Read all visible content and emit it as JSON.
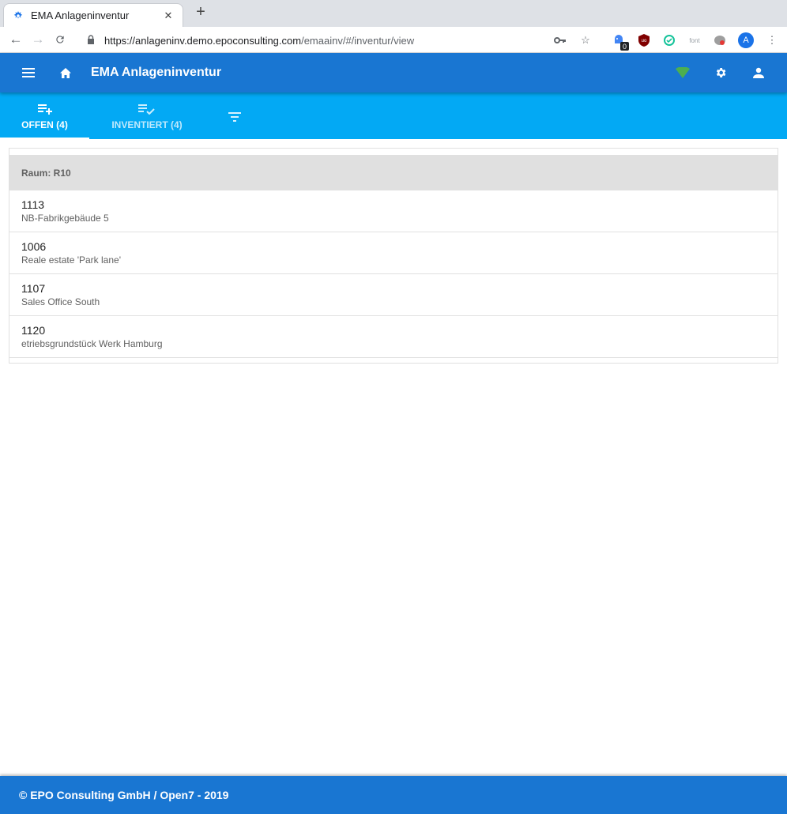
{
  "browser": {
    "tab_title": "EMA Anlageninventur",
    "url_host": "https://anlageninv.demo.epoconsulting.com",
    "url_path": "/emaainv/#/inventur/view",
    "ext_badge": "0",
    "font_ext_label": "font",
    "profile_initial": "A"
  },
  "header": {
    "title": "EMA Anlageninventur",
    "status_color": "#4caf50"
  },
  "tabs": [
    {
      "label": "OFFEN (4)",
      "icon": "playlist-add-icon",
      "active": true
    },
    {
      "label": "INVENTIERT (4)",
      "icon": "playlist-check-icon",
      "active": false
    },
    {
      "label": "",
      "icon": "filter-icon",
      "active": false
    }
  ],
  "content": {
    "section_title": "Raum: R10",
    "items": [
      {
        "number": "1113",
        "description": "NB-Fabrikgebäude 5"
      },
      {
        "number": "1006",
        "description": "Reale estate 'Park lane'"
      },
      {
        "number": "1107",
        "description": "Sales Office South"
      },
      {
        "number": "1120",
        "description": "etriebsgrundstück Werk Hamburg"
      }
    ]
  },
  "footer": {
    "text": "© EPO Consulting GmbH / Open7 - 2019"
  },
  "colors": {
    "header": "#1976d2",
    "tabs": "#03a9f4",
    "section": "#e0e0e0"
  }
}
